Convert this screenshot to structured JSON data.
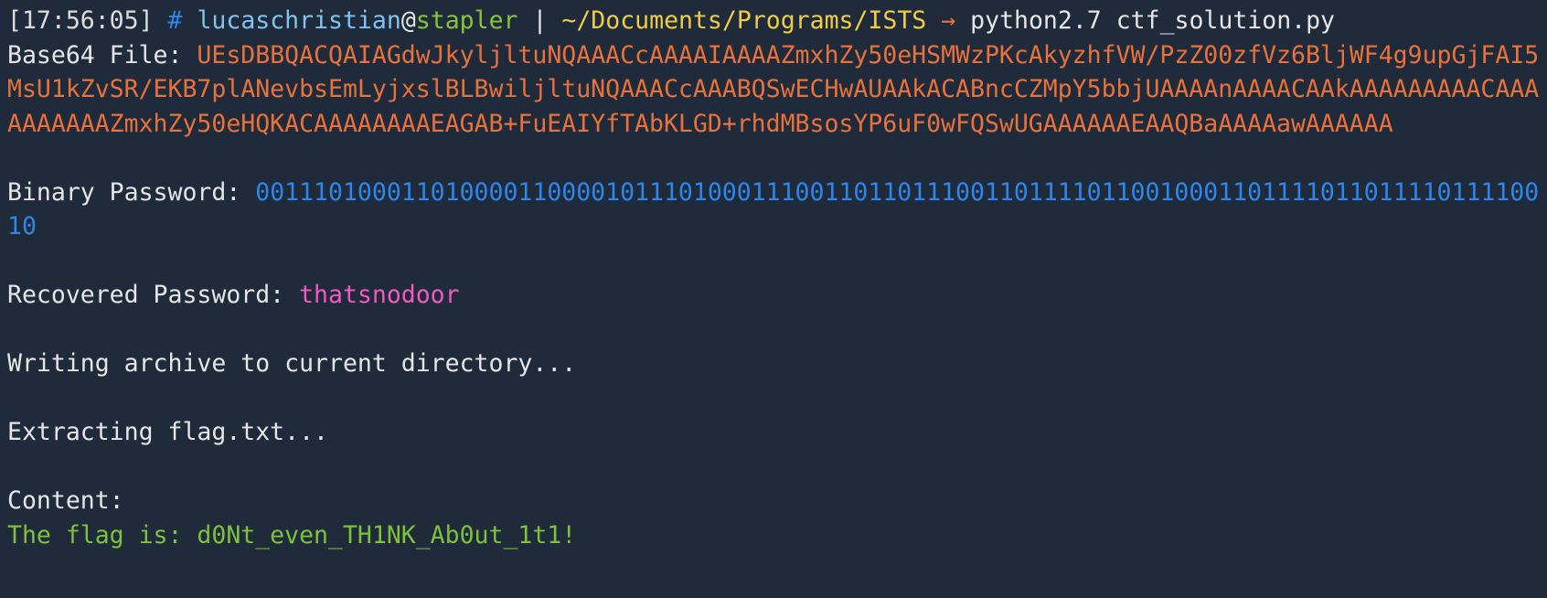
{
  "colors": {
    "background": "#1f2a3a",
    "timestamp": "#dddddd",
    "prompt_hash": "#2f86ea",
    "user": "#7fc3f0",
    "host": "#86c43a",
    "path": "#f2cc43",
    "base64": "#e8723b",
    "binary": "#2f86ea",
    "recovered": "#f05ac3",
    "flag": "#7cc23b"
  },
  "prompt": {
    "timestamp": "[17:56:05]",
    "hash": "#",
    "user": "lucaschristian",
    "at": "@",
    "host": "stapler",
    "separator": "|",
    "path": "~/Documents/Programs/ISTS",
    "arrow": "→",
    "command": "python2.7 ctf_solution.py"
  },
  "output": {
    "base64_label": "Base64 File: ",
    "base64_value": "UEsDBBQACQAIAGdwJkyljltuNQAAACcAAAAIAAAAZmxhZy50eHSMWzPKcAkyzhfVW/PzZ00zfVz6BljWF4g9upGjFAI5MsU1kZvSR/EKB7plANevbsEmLyjxslBLBwiljltuNQAAACcAAABQSwECHwAUAAkACABncCZMpY5bbjUAAAAnAAAACAAkAAAAAAAAACAAAAAAAAAAZmxhZy50eHQKACAAAAAAAAEAGAB+FuEAIYfTAbKLGD+rhdMBsosYP6uF0wFQSwUGAAAAAAEAAQBaAAAAawAAAAAA",
    "binary_label": "Binary Password: ",
    "binary_value": "001110100011010000110000101110100011100110110111001101111011001000110111101101111011110010",
    "recovered_label": "Recovered Password: ",
    "recovered_value": "thatsnodoor",
    "writing": "Writing archive to current directory...",
    "extracting": "Extracting flag.txt...",
    "content_label": "Content:",
    "flag_line": "The flag is: d0Nt_even_TH1NK_Ab0ut_1t1!"
  }
}
